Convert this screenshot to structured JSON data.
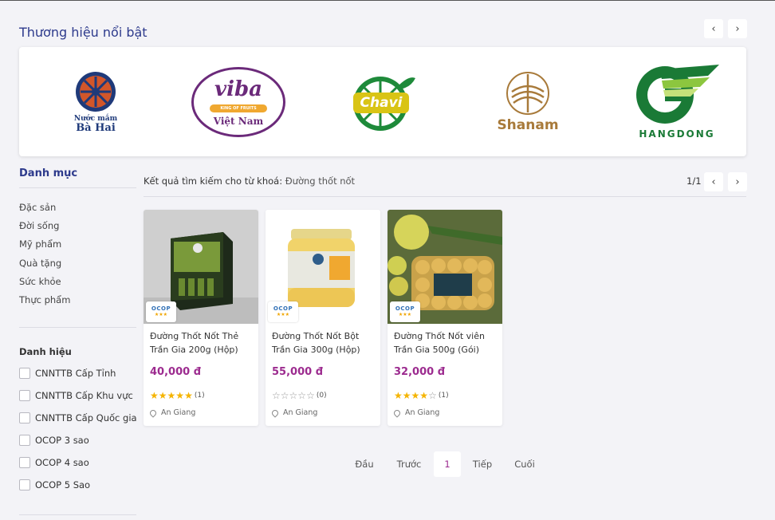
{
  "brands": {
    "title": "Thương hiệu nổi bật",
    "prev_icon": "‹",
    "next_icon": "›",
    "items": [
      {
        "name": "Nước mắm Bà Hai",
        "line1": "Nước mắm",
        "line2": "Bà Hai"
      },
      {
        "name": "Viba",
        "line1": "viba",
        "line2": "KING OF FRUITS",
        "line3": "Việt Nam"
      },
      {
        "name": "Chavi",
        "line1": "Chavi"
      },
      {
        "name": "Shanam",
        "line1": "Shanam"
      },
      {
        "name": "Hangdong",
        "line1": "HANGDONG"
      }
    ]
  },
  "sidebar": {
    "categories_title": "Danh mục",
    "categories": [
      "Đặc sản",
      "Đời sống",
      "Mỹ phẩm",
      "Quà tặng",
      "Sức khỏe",
      "Thực phẩm"
    ],
    "filter_title": "Danh hiệu",
    "filters": [
      "CNNTTB Cấp Tỉnh",
      "CNNTTB Cấp Khu vực",
      "CNNTTB Cấp Quốc gia",
      "OCOP 3 sao",
      "OCOP 4 sao",
      "OCOP 5 Sao"
    ]
  },
  "results": {
    "label": "Kết quả tìm kiếm cho từ khoá:",
    "keyword": "Đường thốt nốt",
    "page_count": "1/1",
    "prev_icon": "‹",
    "next_icon": "›"
  },
  "products": [
    {
      "name": "Đường Thốt Nốt Thẻ Trần Gia 200g (Hộp)",
      "price": "40,000 đ",
      "rating": 5,
      "rating_count": "(1)",
      "location": "An Giang",
      "badge": "OCOP",
      "badge_stars": "★★★"
    },
    {
      "name": "Đường Thốt Nốt Bột Trần Gia 300g (Hộp)",
      "price": "55,000 đ",
      "rating": 0,
      "rating_count": "(0)",
      "location": "An Giang",
      "badge": "OCOP",
      "badge_stars": "★★★"
    },
    {
      "name": "Đường Thốt Nốt viên Trần Gia 500g (Gói)",
      "price": "32,000 đ",
      "rating": 4,
      "rating_count": "(1)",
      "location": "An Giang",
      "badge": "OCOP",
      "badge_stars": "★★★"
    }
  ],
  "pagination": {
    "first": "Đầu",
    "prev": "Trước",
    "current": "1",
    "next": "Tiếp",
    "last": "Cuối"
  },
  "colors": {
    "title": "#2d3a8c",
    "price": "#9c2b8f",
    "star": "#f5b400",
    "background": "#f3f3f7"
  }
}
